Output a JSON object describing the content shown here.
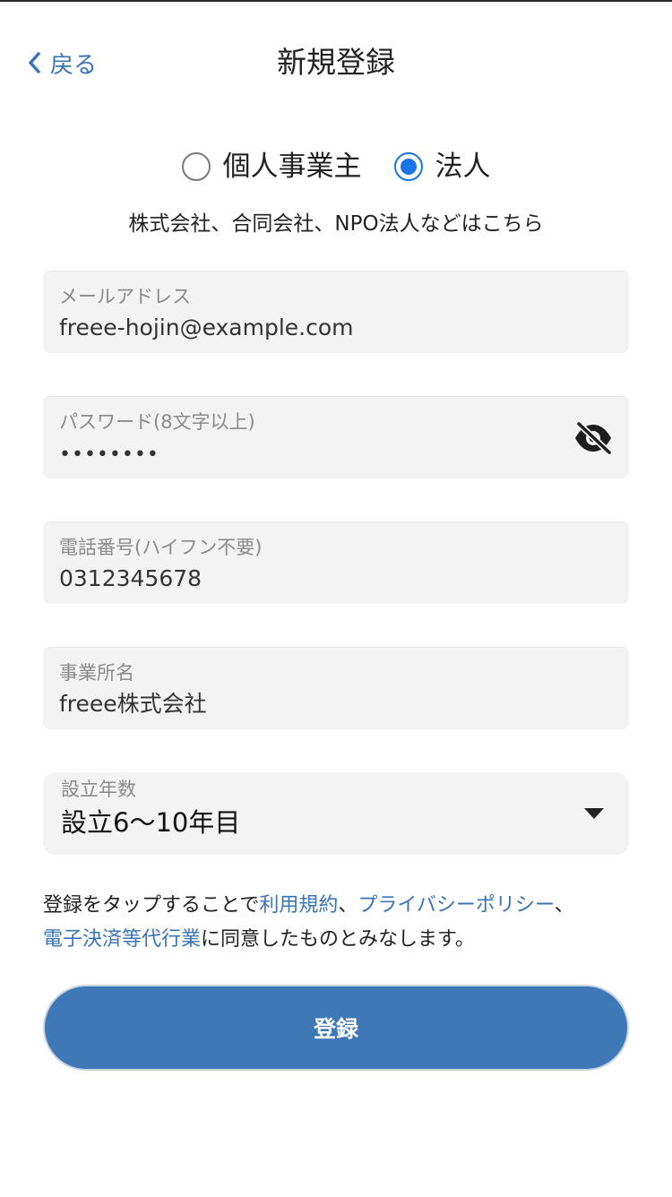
{
  "header": {
    "back_label": "戻る",
    "title": "新規登録"
  },
  "entity_type": {
    "options": [
      {
        "label": "個人事業主",
        "checked": false
      },
      {
        "label": "法人",
        "checked": true
      }
    ],
    "description": "株式会社、合同会社、NPO法人などはこちら"
  },
  "form": {
    "email": {
      "label": "メールアドレス",
      "value": "freee-hojin@example.com"
    },
    "password": {
      "label": "パスワード(8文字以上)",
      "value": "••••••••"
    },
    "phone": {
      "label": "電話番号(ハイフン不要)",
      "value": "0312345678"
    },
    "business_name": {
      "label": "事業所名",
      "value": "freee株式会社"
    },
    "years": {
      "label": "設立年数",
      "value": "設立6〜10年目"
    }
  },
  "consent": {
    "prefix": "登録をタップすることで",
    "terms_link": "利用規約",
    "sep1": "、",
    "privacy_link": "プライバシーポリシー",
    "sep2": "、",
    "payment_link": "電子決済等代行業",
    "suffix": "に同意したものとみなします。"
  },
  "submit_label": "登録",
  "colors": {
    "accent": "#3a74b6",
    "radio_checked": "#1a73e8",
    "button": "#3e78b6",
    "field_bg": "#f3f3f3"
  },
  "icons": {
    "back": "chevron-left-icon",
    "password_toggle": "eye-off-icon",
    "select": "caret-down-icon"
  }
}
